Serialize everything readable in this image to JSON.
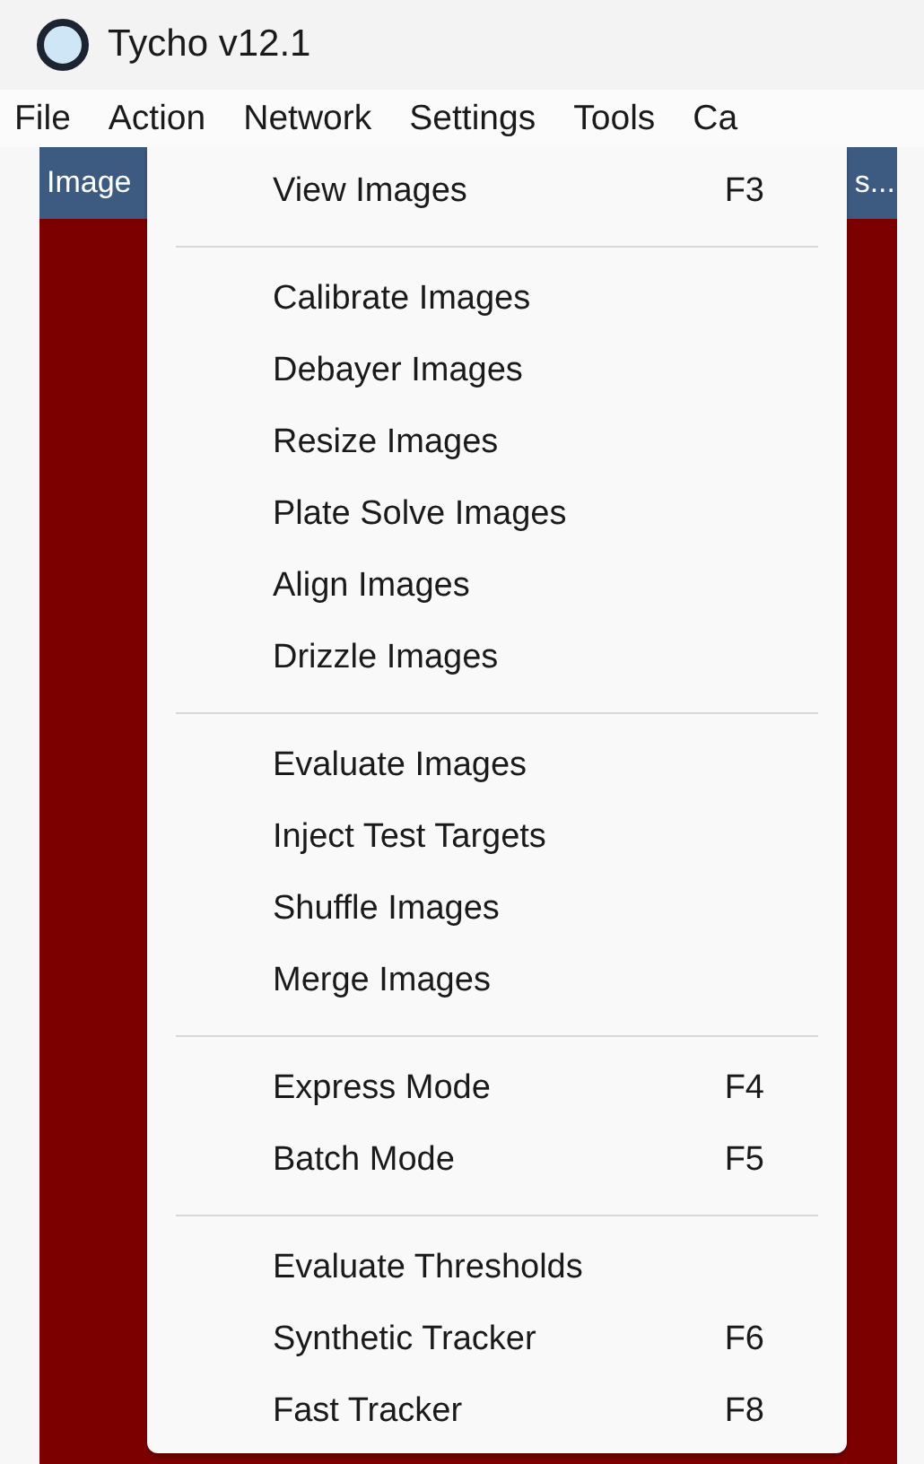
{
  "window": {
    "title": "Tycho v12.1"
  },
  "menubar": [
    {
      "label": "File"
    },
    {
      "label": "Action"
    },
    {
      "label": "Network"
    },
    {
      "label": "Settings"
    },
    {
      "label": "Tools"
    },
    {
      "label": "Ca"
    }
  ],
  "header_bar": {
    "left": "Image",
    "right": "s..."
  },
  "menu": {
    "groups": [
      [
        {
          "label": "View Images",
          "shortcut": "F3"
        }
      ],
      [
        {
          "label": "Calibrate Images"
        },
        {
          "label": "Debayer Images"
        },
        {
          "label": "Resize Images"
        },
        {
          "label": "Plate Solve Images"
        },
        {
          "label": "Align Images"
        },
        {
          "label": "Drizzle Images"
        }
      ],
      [
        {
          "label": "Evaluate Images"
        },
        {
          "label": "Inject Test Targets"
        },
        {
          "label": "Shuffle Images"
        },
        {
          "label": "Merge Images"
        }
      ],
      [
        {
          "label": "Express Mode",
          "shortcut": "F4"
        },
        {
          "label": "Batch Mode",
          "shortcut": "F5"
        }
      ],
      [
        {
          "label": "Evaluate Thresholds"
        },
        {
          "label": "Synthetic Tracker",
          "shortcut": "F6"
        },
        {
          "label": "Fast Tracker",
          "shortcut": "F8"
        }
      ]
    ]
  }
}
